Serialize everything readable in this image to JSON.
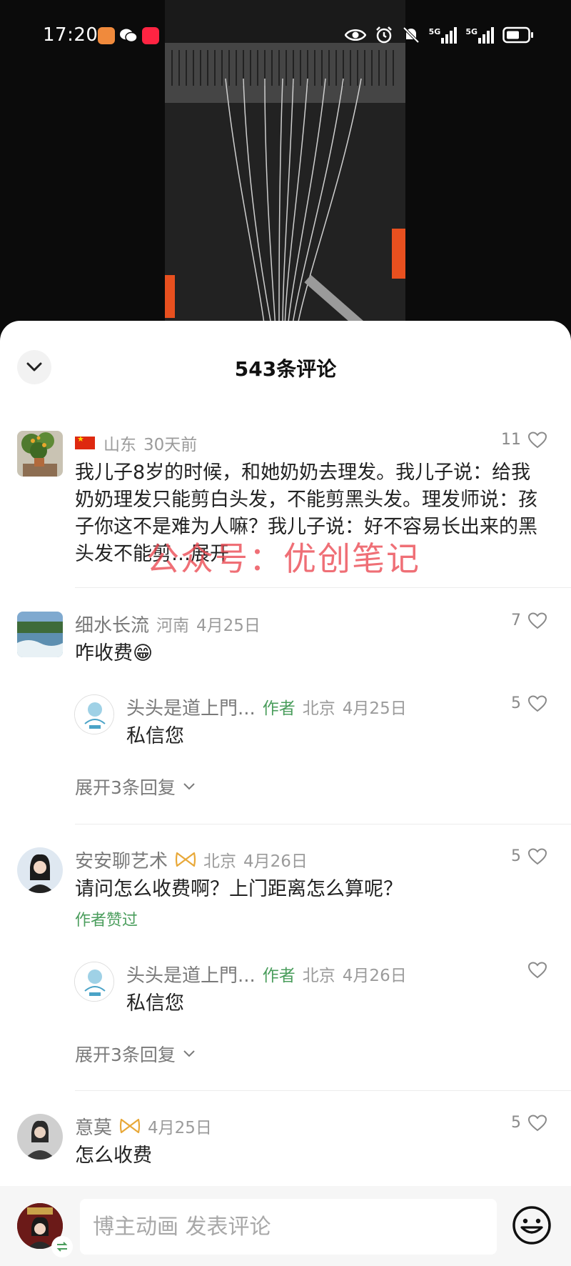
{
  "status_bar": {
    "time": "17:20",
    "icons": [
      "taobao-app-icon",
      "wechat-icon",
      "xiaohongshu-icon",
      "eye-icon",
      "alarm-icon",
      "mute-icon",
      "signal-5g-icon",
      "signal-5g-icon",
      "battery-icon"
    ],
    "net_label_1": "5G",
    "net_label_2": "5G"
  },
  "sheet": {
    "title": "543条评论"
  },
  "comments": [
    {
      "region": "山东",
      "time": "30天前",
      "likes": "11",
      "text": "我儿子8岁的时候，和她奶奶去理发。我儿子说：给我奶奶理发只能剪白头发，不能剪黑头发。理发师说：孩子你这不是难为人嘛？我儿子说：好不容易长出来的黑头发不能剪…",
      "expand_label": "展开"
    },
    {
      "name": "细水长流",
      "region": "河南",
      "time": "4月25日",
      "likes": "7",
      "text": "咋收费😁",
      "reply": {
        "name": "头头是道上門...",
        "tag": "作者",
        "region": "北京",
        "time": "4月25日",
        "likes": "5",
        "text": "私信您"
      },
      "expand_replies": "展开3条回复"
    },
    {
      "name": "安安聊艺术",
      "region": "北京",
      "time": "4月26日",
      "likes": "5",
      "text": "请问怎么收费啊？上门距离怎么算呢？",
      "liked_by_author": "作者赞过",
      "reply": {
        "name": "头头是道上門...",
        "tag": "作者",
        "region": "北京",
        "time": "4月26日",
        "likes": "",
        "text": "私信您"
      },
      "expand_replies": "展开3条回复"
    },
    {
      "name": "意莫",
      "time": "4月25日",
      "likes": "5",
      "text": "怎么收费"
    }
  ],
  "watermark": "公众号：优创笔记",
  "input": {
    "placeholder": "博主动画 发表评论"
  },
  "colors": {
    "author_green": "#4a9d5c",
    "watermark_red": "#eb4650",
    "meta_gray": "#9b9b9b"
  }
}
